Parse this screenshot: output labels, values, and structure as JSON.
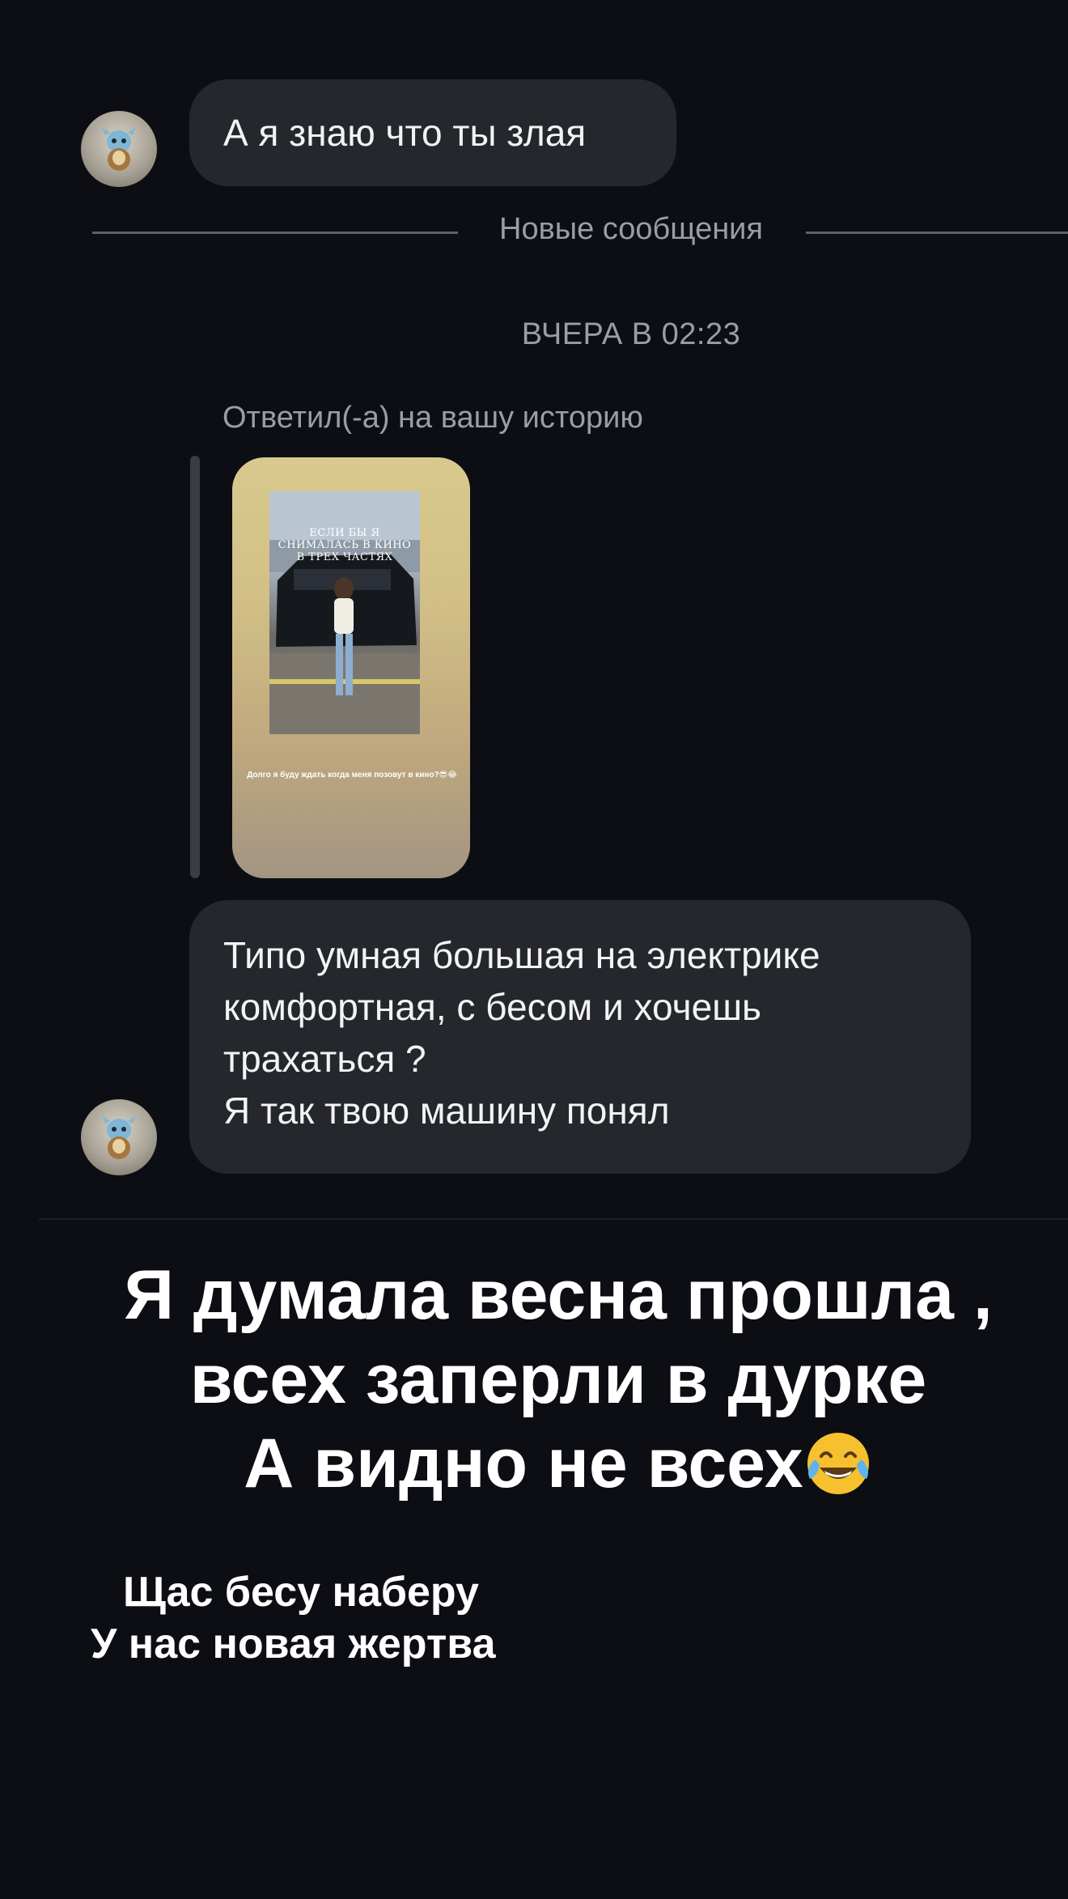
{
  "chat": {
    "messages": [
      {
        "text": "А я знаю что ты злая"
      },
      {
        "lines": [
          "Типо умная большая на электрике",
          "комфортная, с бесом и хочешь",
          "трахаться ?",
          "Я так твою машину понял"
        ]
      }
    ],
    "divider": "Новые сообщения",
    "timestamp": "ВЧЕРА В 02:23",
    "reply_note": "Ответил(-а) на вашу историю",
    "story": {
      "photo_text": "ЕСЛИ БЫ Я СНИМАЛАСЬ В КИНО В ТРЕХ ЧАСТЯХ",
      "caption": "Долго я буду ждать когда меня позовут в кино?😎😂"
    },
    "avatar_icon": "stuffed-toy-avatar"
  },
  "overlay": {
    "big_text_lines": [
      "Я думала весна прошла ,",
      "всех заперли в дурке",
      "А видно не всех"
    ],
    "emoji": "face-with-tears-of-joy",
    "small_text_lines": [
      "Щас бесу наберу",
      "У нас новая жертва"
    ]
  }
}
